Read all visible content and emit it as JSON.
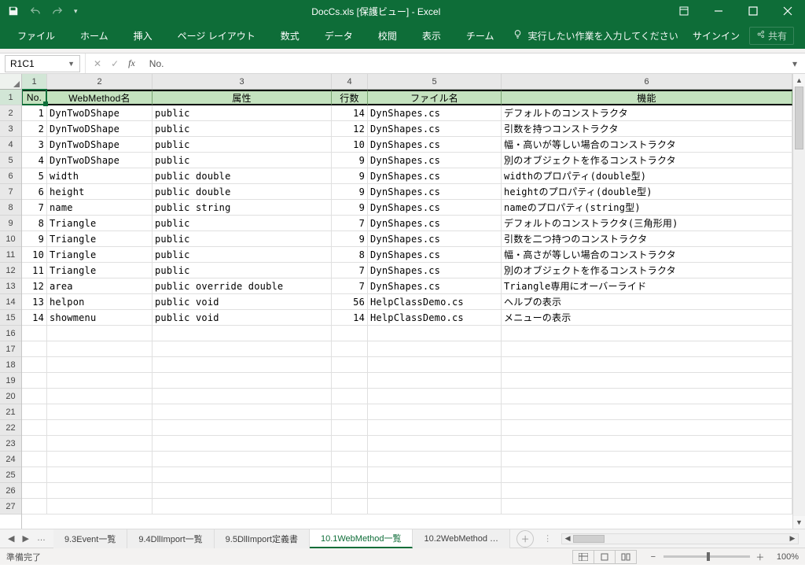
{
  "app": {
    "title": "DocCs.xls  [保護ビュー] - Excel"
  },
  "win": {
    "signin": "サインイン",
    "share": "共有"
  },
  "tabs": {
    "file": "ファイル",
    "home": "ホーム",
    "insert": "挿入",
    "pagelayout": "ページ レイアウト",
    "formulas": "数式",
    "data": "データ",
    "review": "校閲",
    "view": "表示",
    "team": "チーム",
    "tellme": "実行したい作業を入力してください"
  },
  "namebox": {
    "ref": "R1C1",
    "formula": "No."
  },
  "colHeaders": [
    "1",
    "2",
    "3",
    "4",
    "5",
    "6"
  ],
  "rowCount": 27,
  "tableHeaders": [
    "No.",
    "WebMethod名",
    "属性",
    "行数",
    "ファイル名",
    "機能"
  ],
  "rows": [
    {
      "no": "1",
      "name": "DynTwoDShape",
      "attr": "public",
      "lines": "14",
      "file": "DynShapes.cs",
      "func": "デフォルトのコンストラクタ"
    },
    {
      "no": "2",
      "name": "DynTwoDShape",
      "attr": "public",
      "lines": "12",
      "file": "DynShapes.cs",
      "func": "引数を持つコンストラクタ"
    },
    {
      "no": "3",
      "name": "DynTwoDShape",
      "attr": "public",
      "lines": "10",
      "file": "DynShapes.cs",
      "func": "幅・高いが等しい場合のコンストラクタ"
    },
    {
      "no": "4",
      "name": "DynTwoDShape",
      "attr": "public",
      "lines": "9",
      "file": "DynShapes.cs",
      "func": "別のオブジェクトを作るコンストラクタ"
    },
    {
      "no": "5",
      "name": "width",
      "attr": "public double",
      "lines": "9",
      "file": "DynShapes.cs",
      "func": "widthのプロパティ(double型)"
    },
    {
      "no": "6",
      "name": "height",
      "attr": "public double",
      "lines": "9",
      "file": "DynShapes.cs",
      "func": "heightのプロパティ(double型)"
    },
    {
      "no": "7",
      "name": "name",
      "attr": "public string",
      "lines": "9",
      "file": "DynShapes.cs",
      "func": "nameのプロパティ(string型)"
    },
    {
      "no": "8",
      "name": "Triangle",
      "attr": "public",
      "lines": "7",
      "file": "DynShapes.cs",
      "func": "デフォルトのコンストラクタ(三角形用)"
    },
    {
      "no": "9",
      "name": "Triangle",
      "attr": "public",
      "lines": "9",
      "file": "DynShapes.cs",
      "func": "引数を二つ持つのコンストラクタ"
    },
    {
      "no": "10",
      "name": "Triangle",
      "attr": "public",
      "lines": "8",
      "file": "DynShapes.cs",
      "func": "幅・高さが等しい場合のコンストラクタ"
    },
    {
      "no": "11",
      "name": "Triangle",
      "attr": "public",
      "lines": "7",
      "file": "DynShapes.cs",
      "func": "別のオブジェクトを作るコンストラクタ"
    },
    {
      "no": "12",
      "name": "area",
      "attr": "public override double",
      "lines": "7",
      "file": "DynShapes.cs",
      "func": "Triangle専用にオーバーライド"
    },
    {
      "no": "13",
      "name": "helpon",
      "attr": "public void",
      "lines": "56",
      "file": "HelpClassDemo.cs",
      "func": "ヘルプの表示"
    },
    {
      "no": "14",
      "name": "showmenu",
      "attr": "public void",
      "lines": "14",
      "file": "HelpClassDemo.cs",
      "func": "メニューの表示"
    }
  ],
  "sheetTabs": {
    "ellipsis": "…",
    "items": [
      "9.3Event一覧",
      "9.4DllImport一覧",
      "9.5DllImport定義書",
      "10.1WebMethod一覧",
      "10.2WebMethod …"
    ],
    "activeIndex": 3
  },
  "status": {
    "ready": "準備完了",
    "zoom": "100%"
  }
}
